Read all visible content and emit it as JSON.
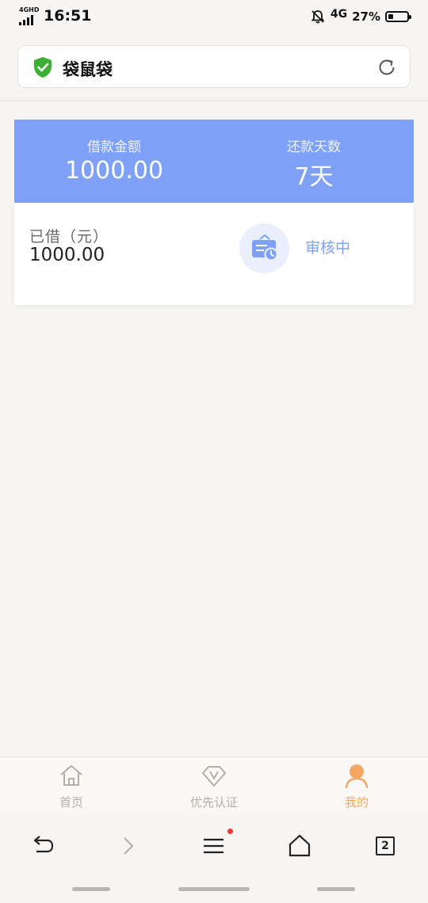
{
  "status_bar": {
    "network_tag": "4GHD",
    "time": "16:51",
    "network": "4G",
    "battery": "27%",
    "battery_level": 0.27
  },
  "address_bar": {
    "title": "袋鼠袋",
    "secure_icon": "shield-check-icon",
    "reload_icon": "reload-icon"
  },
  "loan": {
    "amount_label": "借款金额",
    "amount_value": "1000.00",
    "days_label": "还款天数",
    "days_value": "7天",
    "borrowed_label": "已借（元）",
    "borrowed_value": "1000.00",
    "status_icon": "review-clock-icon",
    "status_text": "审核中"
  },
  "tabbar": {
    "items": [
      {
        "label": "首页",
        "icon": "home-icon",
        "active": false
      },
      {
        "label": "优先认证",
        "icon": "vip-diamond-icon",
        "active": false
      },
      {
        "label": "我的",
        "icon": "user-icon",
        "active": true
      }
    ]
  },
  "browser_toolbar": {
    "tabs_count": "2",
    "icons": [
      "back-icon",
      "forward-icon",
      "menu-icon",
      "home-icon",
      "tabs-icon"
    ]
  },
  "colors": {
    "accent_blue": "#7ea1f7",
    "active_tab": "#f5a660",
    "shield_green": "#3cb035",
    "notification_dot": "#ea3b3b",
    "background": "#f6f5f3"
  }
}
